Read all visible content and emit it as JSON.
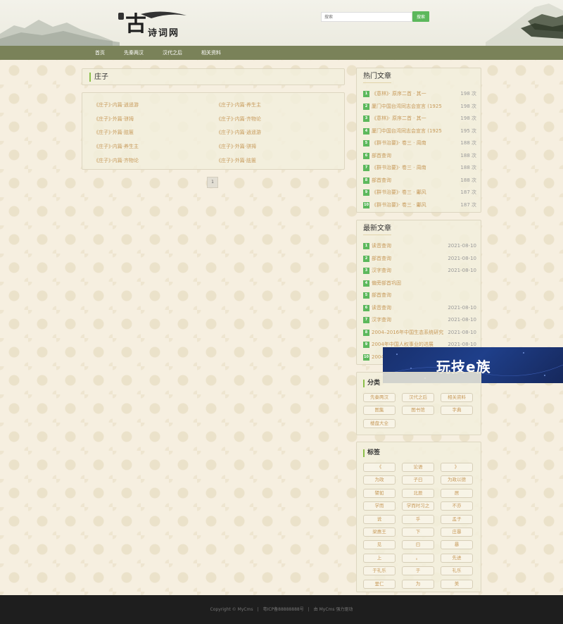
{
  "header": {
    "logo_big": "古",
    "logo_small": "诗词网",
    "search_placeholder": "搜索",
    "search_button": "搜索"
  },
  "nav": [
    "首页",
    "先秦两汉",
    "汉代之后",
    "相关资料"
  ],
  "page_title": "庄子",
  "list": [
    "《庄子》·内篇·逍遥游",
    "《庄子》·内篇·养生主",
    "《庄子》·外篇·骈拇",
    "《庄子》·内篇·齐物论",
    "《庄子》·外篇·胠箧",
    "《庄子》·内篇·逍遥游",
    "《庄子》·内篇·养生主",
    "《庄子》·外篇·骈拇",
    "《庄子》·内篇·齐物论",
    "《庄子》·外篇·胠箧"
  ],
  "pager": "1",
  "hot": {
    "title": "热门文章",
    "items": [
      {
        "rank": "1",
        "text": "《意林》· 原序二首 · 其一",
        "count": "198 次"
      },
      {
        "rank": "2",
        "text": "厦门中国台湾同志会宣言 (1925",
        "count": "198 次"
      },
      {
        "rank": "3",
        "text": "《意林》· 原序二首 · 其一",
        "count": "198 次"
      },
      {
        "rank": "4",
        "text": "厦门中国台湾同志会宣言 (1925",
        "count": "195 次"
      },
      {
        "rank": "5",
        "text": "《群书治要》· 卷三 · 周南",
        "count": "188 次"
      },
      {
        "rank": "6",
        "text": "部首查询",
        "count": "188 次"
      },
      {
        "rank": "7",
        "text": "《群书治要》· 卷三 · 周南",
        "count": "188 次"
      },
      {
        "rank": "8",
        "text": "部首查询",
        "count": "188 次"
      },
      {
        "rank": "9",
        "text": "《群书治要》· 卷三 · 鄘风",
        "count": "187 次"
      },
      {
        "rank": "10",
        "text": "《群书治要》· 卷三 · 鄘风",
        "count": "187 次"
      }
    ]
  },
  "latest": {
    "title": "最新文章",
    "items": [
      {
        "rank": "1",
        "text": "读音查询",
        "date": "2021-08-10"
      },
      {
        "rank": "2",
        "text": "部首查询",
        "date": "2021-08-10"
      },
      {
        "rank": "3",
        "text": "汉字查询",
        "date": "2021-08-10"
      },
      {
        "rank": "4",
        "text": "偏旁部首巩固",
        "date": ""
      },
      {
        "rank": "5",
        "text": "部首查询",
        "date": ""
      },
      {
        "rank": "6",
        "text": "读音查询",
        "date": "2021-08-10"
      },
      {
        "rank": "7",
        "text": "汉字查询",
        "date": "2021-08-10"
      },
      {
        "rank": "8",
        "text": "2004–2016年中国生态系统研究",
        "date": "2021-08-10"
      },
      {
        "rank": "9",
        "text": "2004年中国人权事业的进展",
        "date": "2021-08-10"
      },
      {
        "rank": "10",
        "text": "2004",
        "date": ""
      }
    ]
  },
  "ad": {
    "text": "玩技e族"
  },
  "category": {
    "title": "分类",
    "items": [
      "先秦两汉",
      "汉代之后",
      "相关资料",
      "图集",
      "图书馆",
      "字典",
      "楼盘大全"
    ]
  },
  "tags": {
    "title": "标签",
    "items": [
      "《",
      "论语",
      "》",
      "为政",
      "子曰",
      "为政以德",
      "譬如",
      "北辰",
      "居",
      "学而",
      "学而时习之",
      "不亦",
      "说",
      "乎",
      "孟子",
      "梁惠王",
      "下",
      "庄暴",
      "见",
      "曰",
      "暴",
      "上",
      "。",
      "先进",
      "于礼乐",
      "于",
      "礼乐",
      "里仁",
      "为",
      "美"
    ]
  },
  "footer": "Copyright © MyCms　|　粤ICP备88888888号　|　由 MyCms 强力驱动",
  "colors": {
    "nav": "#7a8259",
    "accent": "#5cb85c",
    "link": "#c79a5a",
    "footer": "#1e1e1e"
  }
}
